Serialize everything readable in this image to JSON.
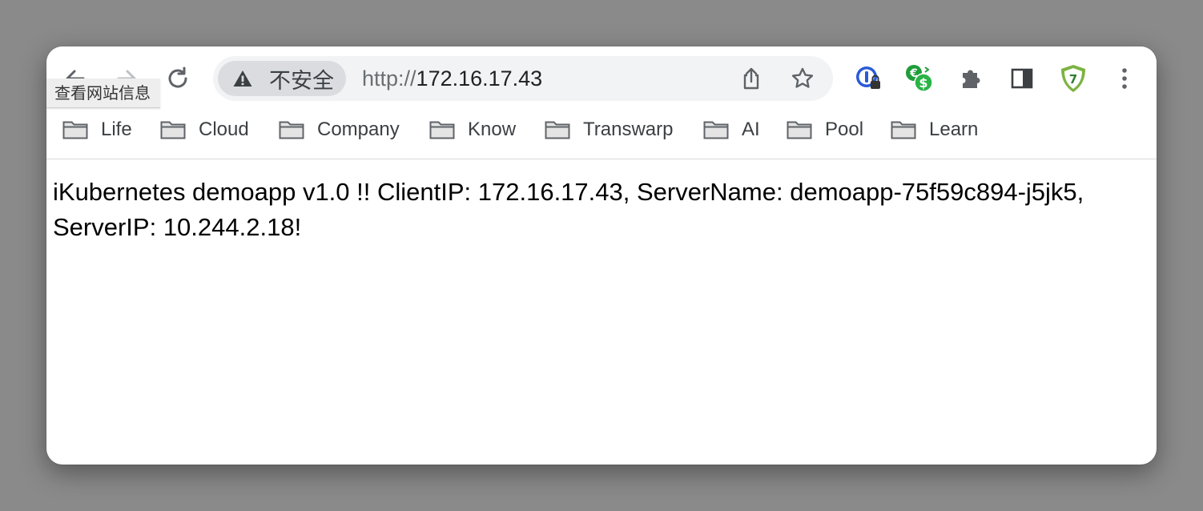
{
  "toolbar": {
    "tooltip": "查看网站信息",
    "security_label": "不安全",
    "url_scheme": "http://",
    "url_host": "172.16.17.43"
  },
  "bookmarks": [
    {
      "label": "Life"
    },
    {
      "label": "Cloud"
    },
    {
      "label": "Company"
    },
    {
      "label": "Know"
    },
    {
      "label": "Transwarp"
    },
    {
      "label": "AI"
    },
    {
      "label": "Pool"
    },
    {
      "label": "Learn"
    }
  ],
  "page": {
    "body_text": "iKubernetes demoapp v1.0 !! ClientIP: 172.16.17.43, ServerName: demoapp-75f59c894-j5jk5, ServerIP: 10.244.2.18!"
  },
  "icons": {
    "back": "arrow-left-icon",
    "forward": "arrow-right-icon",
    "reload": "reload-icon",
    "warning": "warning-icon",
    "share": "share-icon",
    "bookmark_star": "star-icon",
    "ext_1": "password-manager-extension-icon",
    "ext_2": "currency-converter-extension-icon",
    "extensions": "puzzle-icon",
    "side_panel": "side-panel-icon",
    "ext_3": "shield-extension-icon",
    "menu": "kebab-menu-icon",
    "folder": "folder-icon"
  }
}
